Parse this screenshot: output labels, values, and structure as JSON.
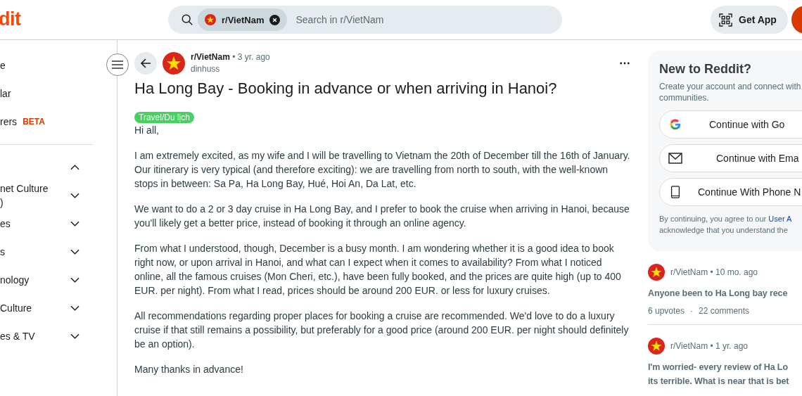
{
  "header": {
    "logo": "dit",
    "search": {
      "community": "r/VietNam",
      "placeholder": "Search in r/VietNam"
    },
    "get_app": "Get App"
  },
  "sidebar": {
    "items": [
      {
        "label": "e"
      },
      {
        "label": "lar"
      },
      {
        "label": "rers",
        "badge": "BETA"
      }
    ],
    "sections": [
      {
        "expanded": true
      },
      {
        "label": "net Culture\n)",
        "expanded": false
      },
      {
        "label": "es",
        "expanded": false
      },
      {
        "label": "s",
        "expanded": false
      },
      {
        "label": "nology",
        "expanded": false
      },
      {
        "label": "Culture",
        "expanded": false
      },
      {
        "label": "es & TV",
        "expanded": false
      }
    ]
  },
  "post": {
    "community": "r/VietNam",
    "time": "• 3 yr. ago",
    "author": "dinhuss",
    "title": "Ha Long Bay - Booking in advance or when arriving in Hanoi?",
    "flair": "Travel/Du lịch",
    "paragraphs": [
      "Hi all,",
      "I am extremely excited, as my wife and I will be travelling to Vietnam the 20th of December till the 16th of January. Our itinerary is very typical (and therefore exciting): we are travelling from north to south, with the well-known stops in between: Sa Pa, Ha Long Bay, Hué, Hoi An, Da Lat, etc.",
      "We want to do a 2 or 3 day cruise in Ha Long Bay, and I prefer to book the cruise when arriving in Hanoi, because you'll likely get a better price, instead of booking it through an online agency.",
      "From what I understood, though, December is a busy month. I am wondering whether it is a good idea to book right now, or upon arrival in Hanoi, and what can I expect when it comes to availability? From what I noticed online, all the famous cruises (Mon Cheri, etc.), have been fully booked, and the prices are quite high (up to 400 EUR. per night). From what I read, prices should be around 200 EUR. or less for luxury cruises.",
      "All recommendations regarding proper places for booking a cruise are recommended. We'd love to do a luxury cruise if that still remains a possibility, but preferably for a good price (around 200 EUR. per night should definitely be an option).",
      "Many thanks in advance!"
    ]
  },
  "signup": {
    "title": "New to Reddit?",
    "subtitle": "Create your account and connect with\ncommunities.",
    "buttons": [
      {
        "kind": "google",
        "label": "Continue with Go"
      },
      {
        "kind": "email",
        "label": "Continue with Ema"
      },
      {
        "kind": "phone",
        "label": "Continue With Phone N"
      }
    ],
    "legal": "By continuing, you agree to our ",
    "legal_link": "User A",
    "legal_2": "acknowledge that you understand the"
  },
  "related": [
    {
      "community": "r/VietNam",
      "time": "• 10 mo. ago",
      "title": "Anyone been to Ha Long bay rece",
      "upvotes": "6 upvotes",
      "separator": "·",
      "comments": "22 comments"
    },
    {
      "community": "r/VietNam",
      "time": "• 1 yr. ago",
      "title": "I'm worried- every review of Ha Lo\nits terrible. What is near that is bet"
    }
  ]
}
